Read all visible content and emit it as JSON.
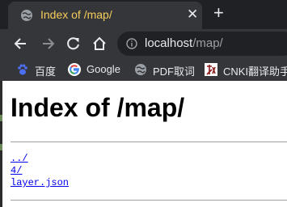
{
  "tab": {
    "title": "Index of /map/",
    "close_glyph": "✕"
  },
  "newtab_glyph": "+",
  "toolbar": {
    "back_icon": "arrow-left-icon",
    "forward_icon": "arrow-right-icon",
    "reload_icon": "reload-icon",
    "home_icon": "home-icon"
  },
  "address": {
    "host": "localhost",
    "path": "/map/"
  },
  "bookmarks": [
    {
      "label": "百度",
      "icon": "baidu-paw-icon"
    },
    {
      "label": "Google",
      "icon": "google-g-icon"
    },
    {
      "label": "PDF取词",
      "icon": "globe-icon"
    },
    {
      "label": "CNKI翻译助手",
      "icon": "cnki-icon"
    }
  ],
  "page": {
    "heading": "Index of /map/",
    "links": [
      "../",
      "4/",
      "layer.json"
    ]
  },
  "colors": {
    "tabstrip": "#202124",
    "toolbar": "#35363a",
    "tab_title": "#f5cd5b",
    "link": "#0000ee"
  }
}
